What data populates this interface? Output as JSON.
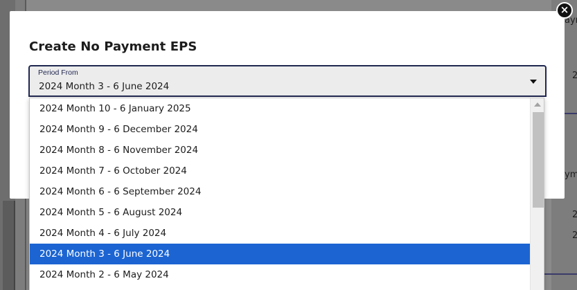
{
  "modal": {
    "title": "Create No Payment EPS",
    "close_symbol": "×"
  },
  "period_from": {
    "label": "Period From",
    "value": "2024 Month 3 - 6 June 2024"
  },
  "dropdown": {
    "options": [
      "2024 Month 10 - 6 January 2025",
      "2024 Month 9 - 6 December 2024",
      "2024 Month 8 - 6 November 2024",
      "2024 Month 7 - 6 October 2024",
      "2024 Month 6 - 6 September 2024",
      "2024 Month 5 - 6 August 2024",
      "2024 Month 4 - 6 July 2024",
      "2024 Month 3 - 6 June 2024",
      "2024 Month 2 - 6 May 2024"
    ],
    "selected_index": 7
  },
  "background": {
    "fragments": [
      "ayme",
      "2",
      "ym",
      "2",
      "2"
    ]
  },
  "colors": {
    "selected_option": "#1b64d2",
    "field_border": "#1f2650"
  }
}
